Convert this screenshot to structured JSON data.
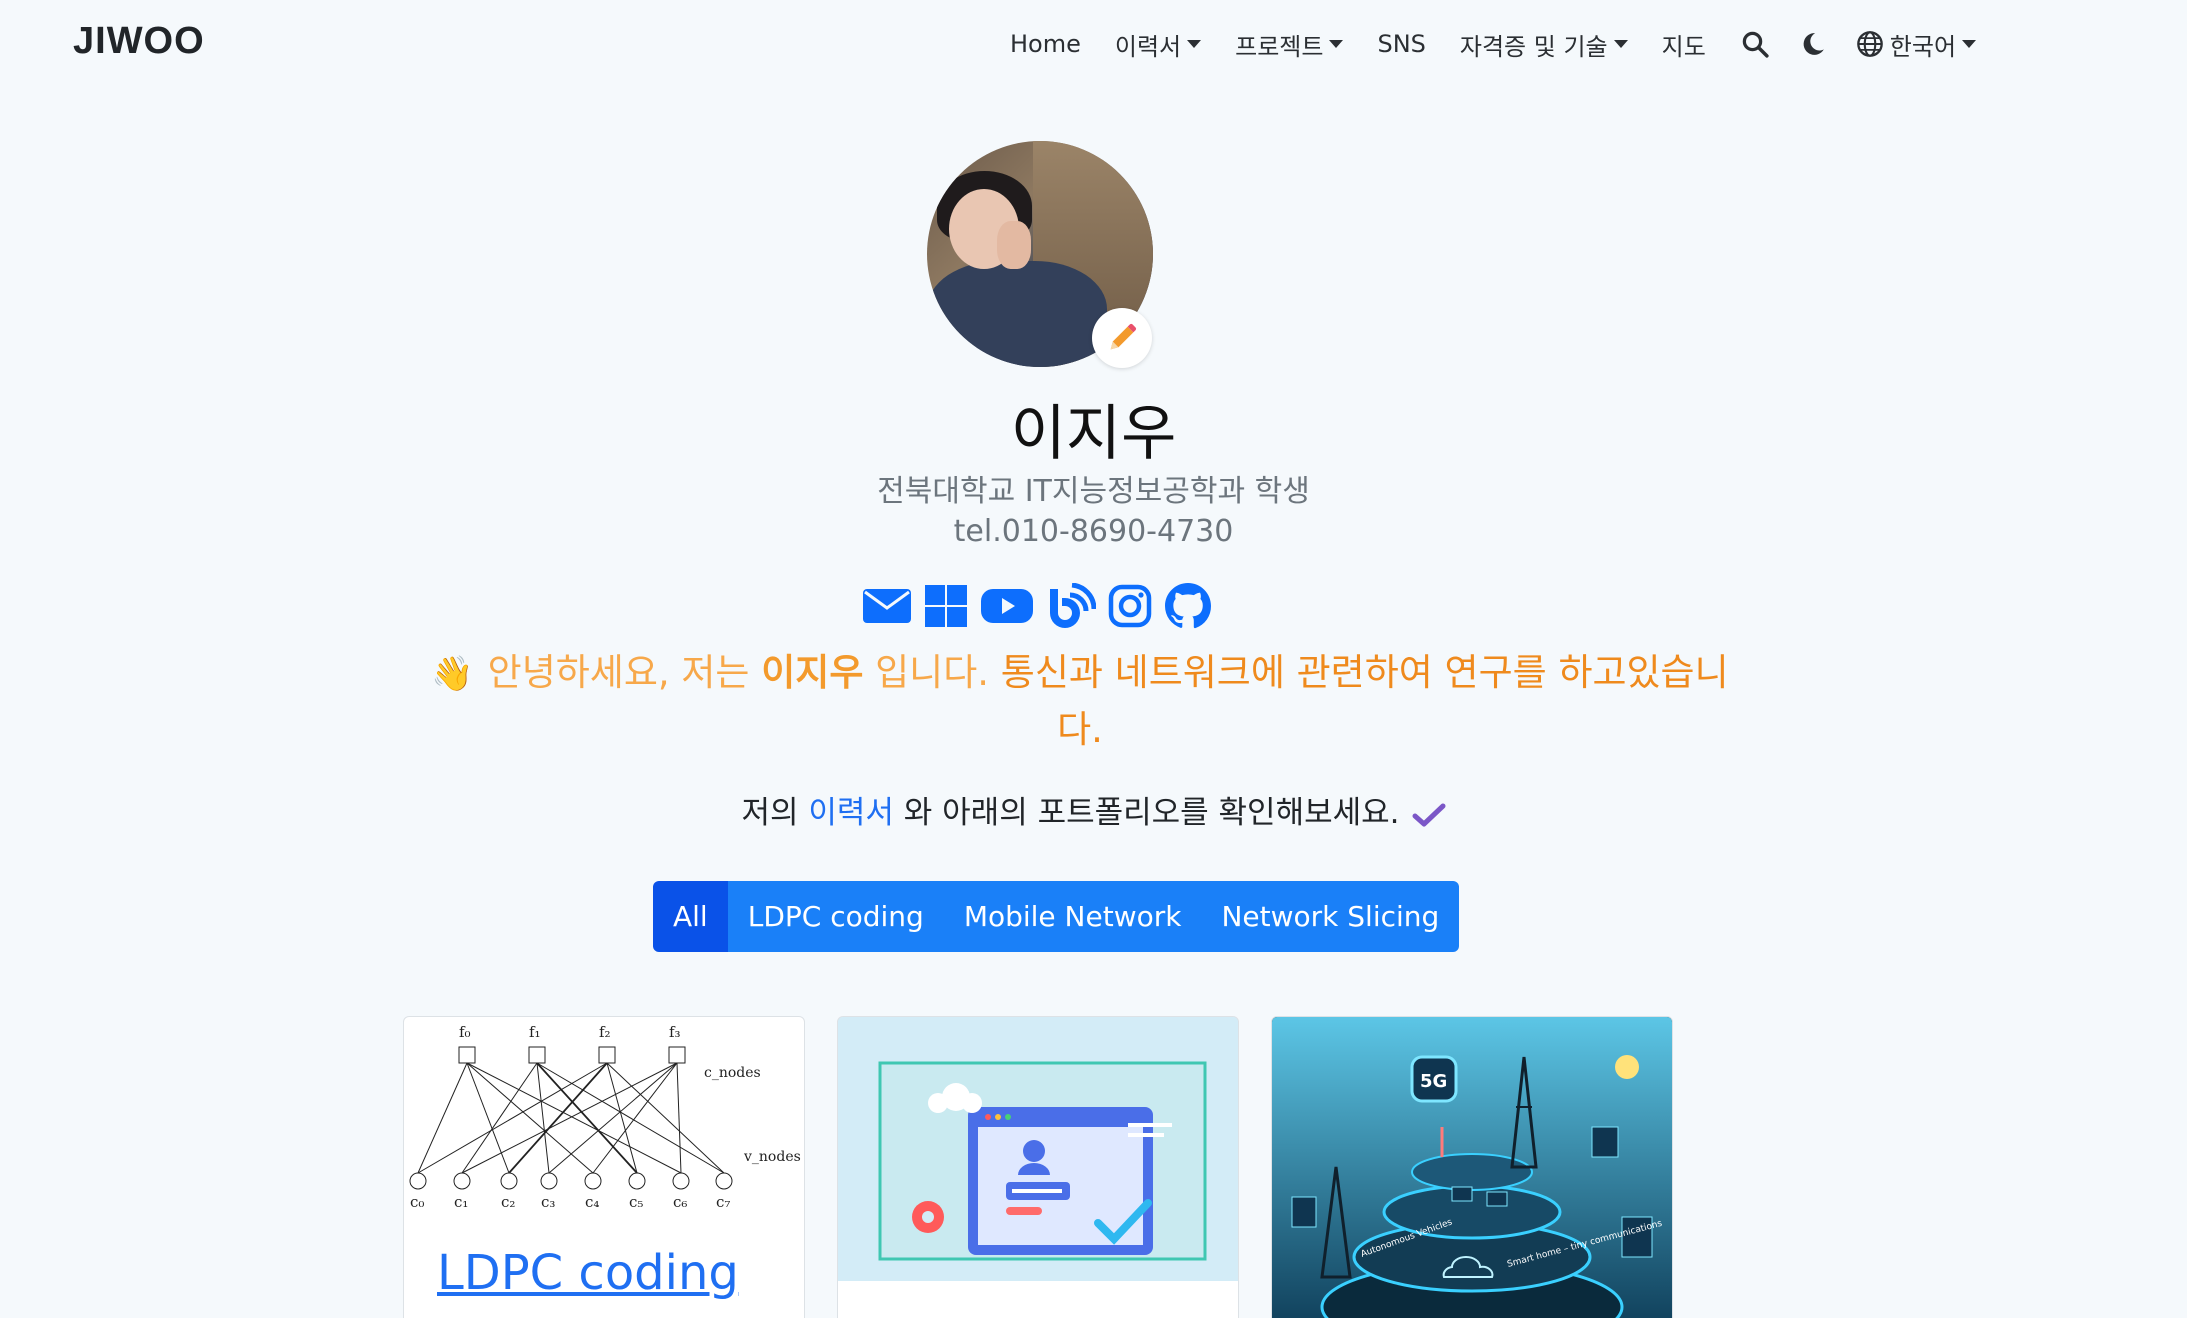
{
  "nav": {
    "brand": "JIWOO",
    "items": [
      {
        "label": "Home",
        "dropdown": false
      },
      {
        "label": "이력서",
        "dropdown": true
      },
      {
        "label": "프로젝트",
        "dropdown": true
      },
      {
        "label": "SNS",
        "dropdown": false
      },
      {
        "label": "자격증 및 기술",
        "dropdown": true
      },
      {
        "label": "지도",
        "dropdown": false
      }
    ],
    "language": "한국어",
    "icons": [
      "search-icon",
      "moon-icon",
      "globe-icon"
    ]
  },
  "profile": {
    "name": "이지우",
    "subtitle": "전북대학교 IT지능정보공학과 학생",
    "phone": "tel.010-8690-4730",
    "social_icons": [
      "email-icon",
      "windows-icon",
      "youtube-icon",
      "blog-icon",
      "instagram-icon",
      "github-icon"
    ],
    "greeting_prefix": "안녕하세요, 저는",
    "greeting_name": "이지우",
    "greeting_middle": "입니다.",
    "greeting_rest": "통신과 네트워크에 관련하여 연구를 하고있습니다.",
    "resume_before": "저의",
    "resume_link": "이력서",
    "resume_after": "와 아래의 포트폴리오를 확인해보세요."
  },
  "filters": [
    "All",
    "LDPC coding",
    "Mobile Network",
    "Network Slicing"
  ],
  "active_filter": "All",
  "cards": [
    {
      "title": "LDPC coding",
      "image": "ldpc-tanner-graph"
    },
    {
      "title": "",
      "image": "login-illustration"
    },
    {
      "title": "",
      "image": "5g-network-illustration"
    }
  ],
  "ldpc_graph": {
    "f_labels": [
      "f₀",
      "f₁",
      "f₂",
      "f₃"
    ],
    "c_labels": [
      "c₀",
      "c₁",
      "c₂",
      "c₃",
      "c₄",
      "c₅",
      "c₆",
      "c₇"
    ],
    "c_nodes_label": "c_nodes",
    "v_nodes_label": "v_nodes"
  },
  "card3_text": {
    "badge": "5G",
    "label_left": "Autonomous Vehicles",
    "label_right": "Smart home – tiny communications"
  },
  "colors": {
    "accent": "#1a80f8",
    "accent_active": "#0a52e8",
    "greeting": "#f7a84a",
    "link": "#1f6ff2"
  }
}
